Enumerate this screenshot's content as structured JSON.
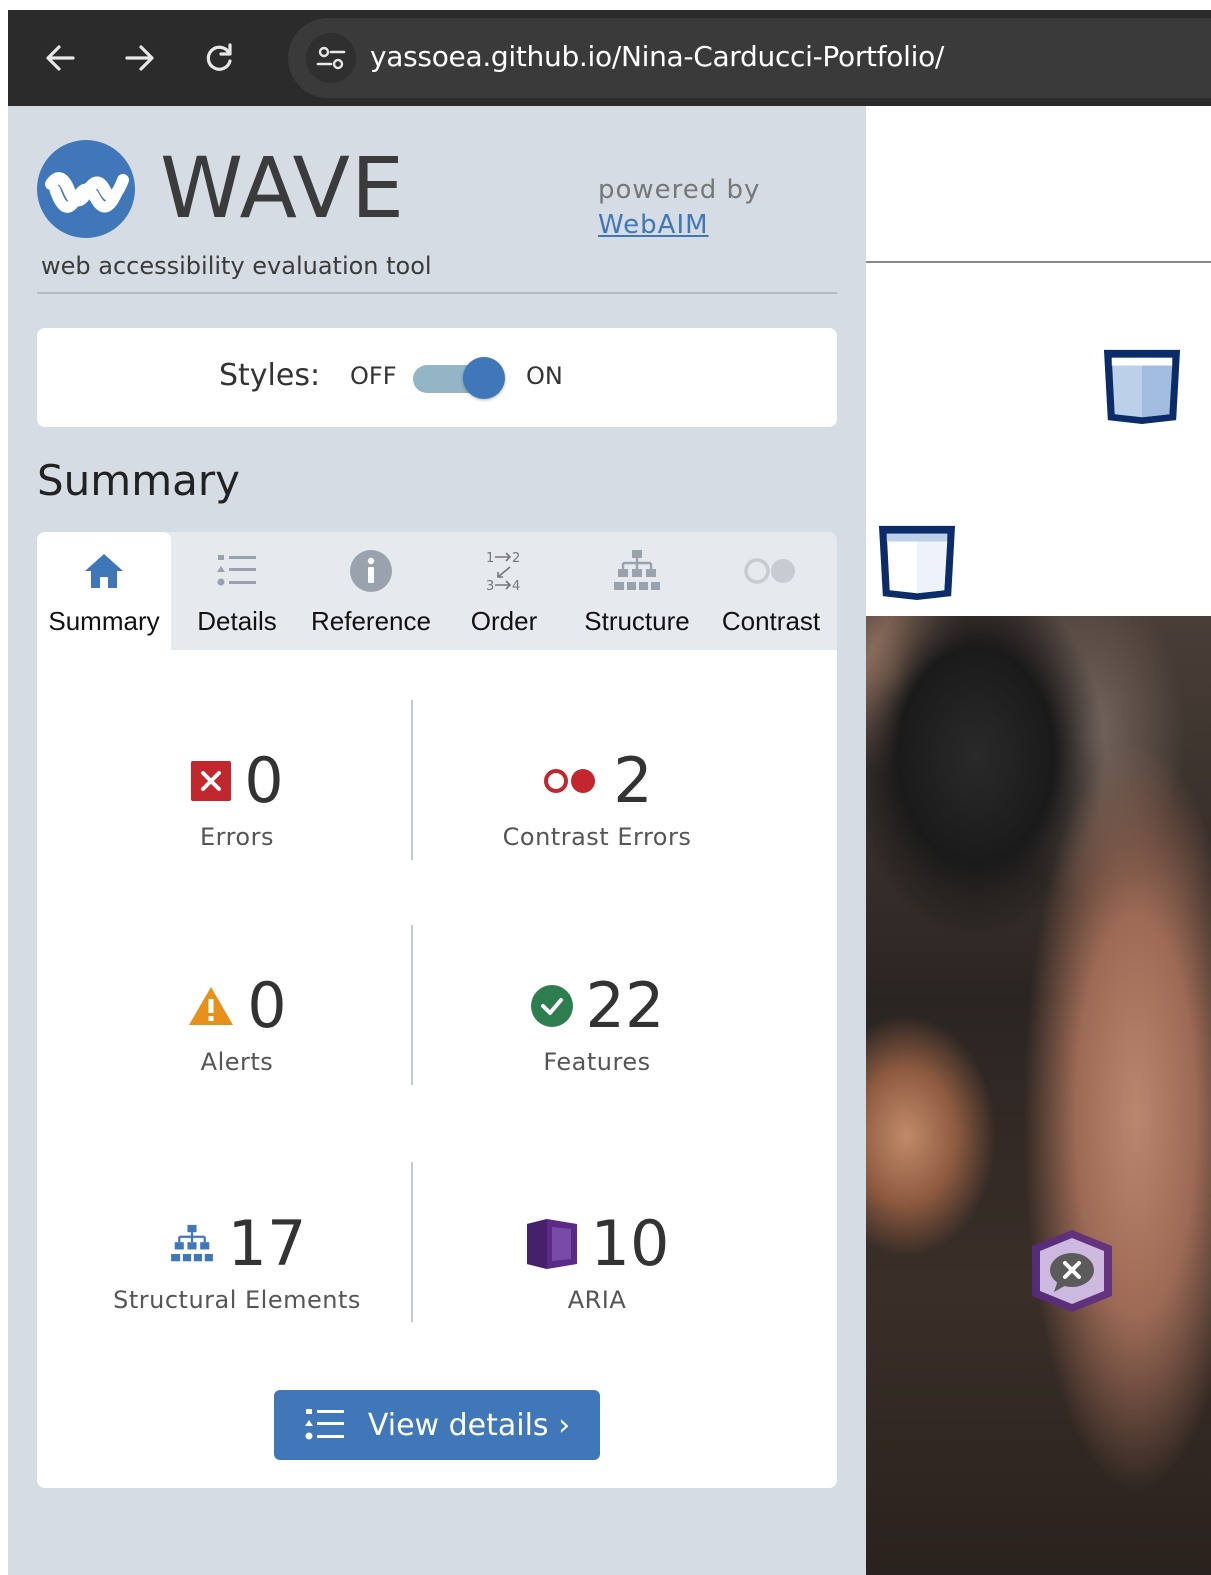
{
  "browser": {
    "url": "yassoea.github.io/Nina-Carducci-Portfolio/"
  },
  "wave": {
    "title": "WAVE",
    "subtitle": "web accessibility evaluation tool",
    "powered_by": "powered by",
    "powered_by_link": "WebAIM",
    "styles": {
      "label": "Styles:",
      "off": "OFF",
      "on": "ON",
      "state": "on"
    },
    "heading": "Summary",
    "tabs": [
      {
        "label": "Summary",
        "icon": "home-icon",
        "active": true
      },
      {
        "label": "Details",
        "icon": "list-icon",
        "active": false
      },
      {
        "label": "Reference",
        "icon": "info-icon",
        "active": false
      },
      {
        "label": "Order",
        "icon": "order-icon",
        "active": false
      },
      {
        "label": "Structure",
        "icon": "hierarchy-icon",
        "active": false
      },
      {
        "label": "Contrast",
        "icon": "contrast-icon",
        "active": false
      }
    ],
    "stats": {
      "errors": {
        "count": "0",
        "label": "Errors",
        "color": "#c1272d"
      },
      "contrast_errors": {
        "count": "2",
        "label": "Contrast Errors",
        "color": "#c1272d"
      },
      "alerts": {
        "count": "0",
        "label": "Alerts",
        "color": "#e8911a"
      },
      "features": {
        "count": "22",
        "label": "Features",
        "color": "#2e7d4f"
      },
      "structural": {
        "count": "17",
        "label": "Structural Elements",
        "color": "#3f77b8"
      },
      "aria": {
        "count": "10",
        "label": "ARIA",
        "color": "#5b2a86"
      }
    },
    "view_details": "View details ›"
  },
  "colors": {
    "accent": "#3f77b8",
    "sidebar_bg": "#d6dce4",
    "browser_bar": "#2b2b2b"
  }
}
